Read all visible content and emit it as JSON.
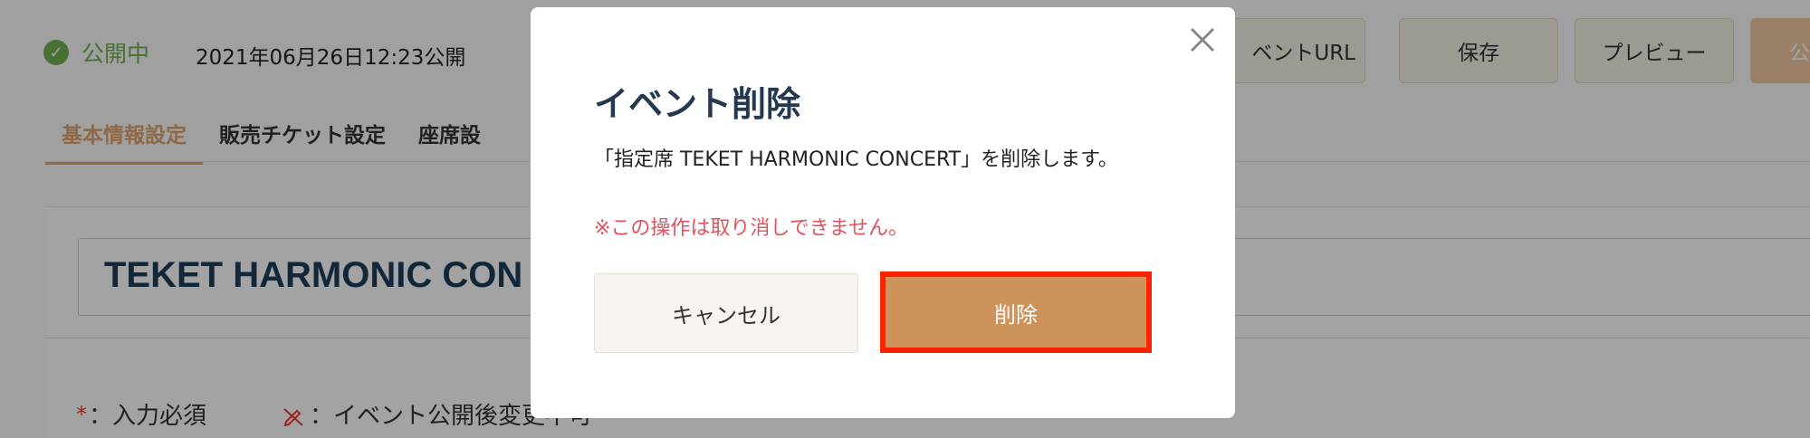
{
  "header": {
    "status_label": "公開中",
    "status_icon": "check-circle-icon",
    "published_at": "2021年06月26日12:23公開",
    "buttons": {
      "event_url": "ベントURL",
      "save": "保存",
      "preview": "プレビュー",
      "publish": "公"
    }
  },
  "tabs": [
    {
      "label": "基本情報設定",
      "active": true
    },
    {
      "label": "販売チケット設定",
      "active": false
    },
    {
      "label": "座席設",
      "active": false
    }
  ],
  "form": {
    "event_title": "TEKET HARMONIC CON",
    "required_mark": "*",
    "required_legend": "：入力必須",
    "locked_legend": "：イベント公開後変更不可"
  },
  "modal": {
    "title": "イベント削除",
    "message": "「指定席 TEKET HARMONIC CONCERT」を削除します。",
    "warning": "※この操作は取り消しできません。",
    "cancel_label": "キャンセル",
    "delete_label": "削除"
  },
  "colors": {
    "accent": "#e0a36e",
    "status_green": "#6fb04f",
    "delete_button": "#ce935b",
    "highlight_border": "#ff2200",
    "warning_text": "#e0535e"
  }
}
